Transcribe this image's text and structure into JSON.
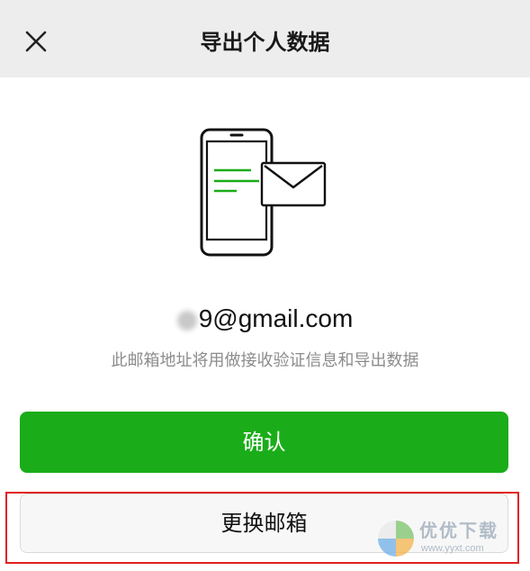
{
  "header": {
    "title": "导出个人数据",
    "close_icon": "close-icon"
  },
  "illustration": {
    "icon": "phone-with-envelope-icon",
    "accent_color": "#1aad19"
  },
  "email": {
    "visible_part": "9@gmail.com"
  },
  "hint": "此邮箱地址将用做接收验证信息和导出数据",
  "buttons": {
    "confirm_label": "确认",
    "change_label": "更换邮箱"
  },
  "colors": {
    "primary": "#1aad19",
    "nav_bg": "#ededed",
    "highlight": "#e02020"
  },
  "watermark": {
    "name": "优优下载",
    "url": "www.yyxt.com"
  }
}
